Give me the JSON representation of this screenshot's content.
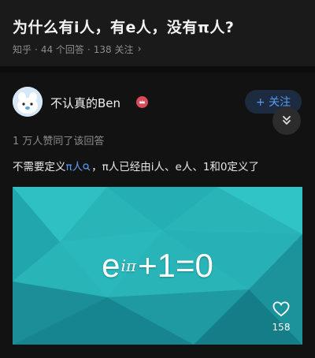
{
  "question": {
    "title": "为什么有i人，有e人，没有π人?",
    "source": "知乎",
    "answers": "44 个回答",
    "followers": "138 关注",
    "separator": "·"
  },
  "author": {
    "name": "不认真的Ben",
    "follow_label": "+ 关注"
  },
  "answer": {
    "upvotes": "1 万人赞同了该回答",
    "text_before": "不需要定义",
    "link_text": "π人",
    "text_after": "，π人已经由i人、e人、1和0定义了",
    "image_formula": {
      "base": "e",
      "exponent": "iπ",
      "rest": "+1=0"
    },
    "like_count": "158"
  },
  "colors": {
    "accent": "#5a9bf0",
    "image_bg": "#29b4b8",
    "badge": "#d94b5b"
  },
  "icons": [
    "chevron-right-icon",
    "badge-icon",
    "chevron-double-down-icon",
    "search-icon",
    "heart-icon"
  ]
}
